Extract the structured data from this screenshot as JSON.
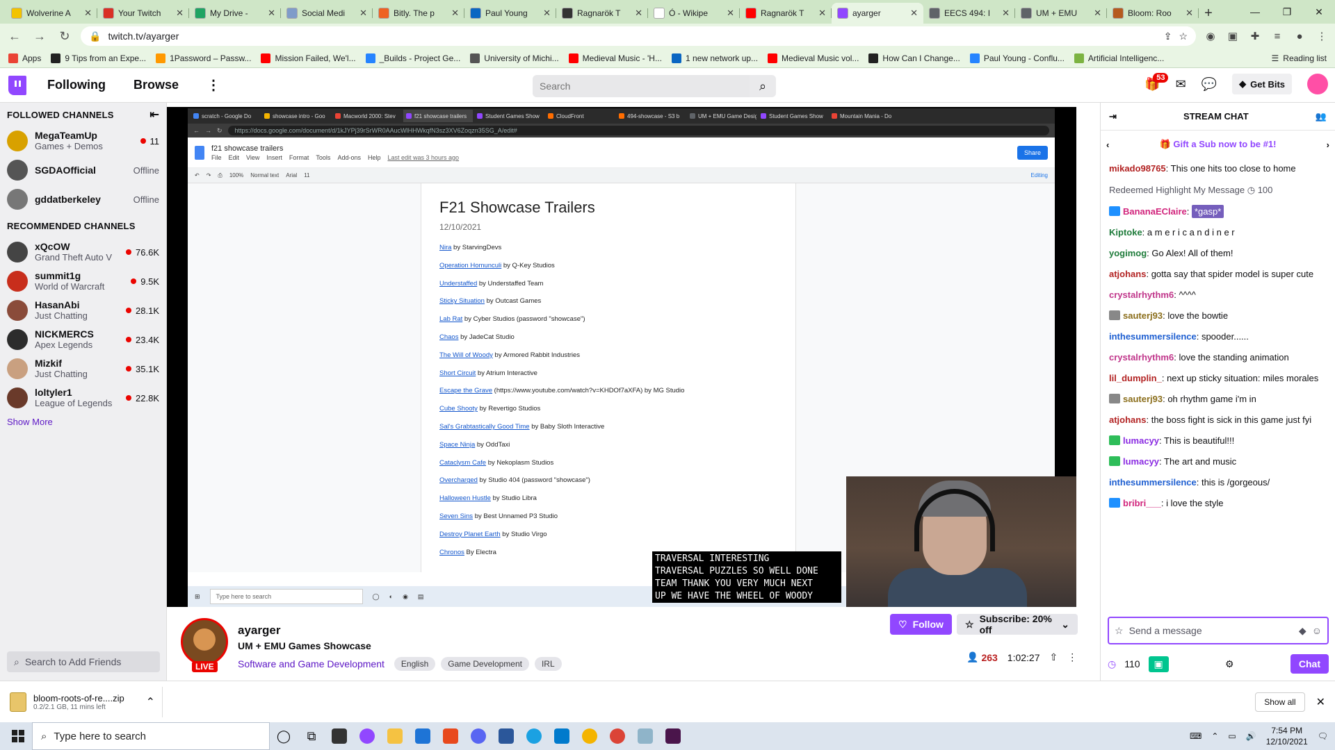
{
  "browser": {
    "tabs": [
      {
        "title": "Wolverine A",
        "color": "#f2c300"
      },
      {
        "title": "Your Twitch",
        "color": "#d93025"
      },
      {
        "title": "My Drive -",
        "color": "#1fa463"
      },
      {
        "title": "Social Medi",
        "color": "#7f9cc9"
      },
      {
        "title": "Bitly. The p",
        "color": "#ee6123"
      },
      {
        "title": "Paul Young",
        "color": "#0a66c2"
      },
      {
        "title": "Ragnarök T",
        "color": "#333333"
      },
      {
        "title": "Ó - Wikipe",
        "color": "#ffffff"
      },
      {
        "title": "Ragnarök T",
        "color": "#ff0000"
      },
      {
        "title": "ayarger",
        "color": "#9147ff"
      },
      {
        "title": "EECS 494: I",
        "color": "#5f6368"
      },
      {
        "title": "UM + EMU",
        "color": "#5f6368"
      },
      {
        "title": "Bloom: Roo",
        "color": "#b55a1e"
      }
    ],
    "url": "twitch.tv/ayarger",
    "bookmarks": [
      {
        "label": "Apps",
        "color": "#ea4335"
      },
      {
        "label": "9 Tips from an Expe...",
        "color": "#222222"
      },
      {
        "label": "1Password – Passw...",
        "color": "#ff9900"
      },
      {
        "label": "Mission Failed, We'l...",
        "color": "#ff0000"
      },
      {
        "label": "_Builds - Project Ge...",
        "color": "#2684ff"
      },
      {
        "label": "University of Michi...",
        "color": "#555555"
      },
      {
        "label": "Medieval Music - 'H...",
        "color": "#ff0000"
      },
      {
        "label": "1 new network up...",
        "color": "#0a66c2"
      },
      {
        "label": "Medieval Music vol...",
        "color": "#ff0000"
      },
      {
        "label": "How Can I Change...",
        "color": "#222222"
      },
      {
        "label": "Paul Young - Conflu...",
        "color": "#2684ff"
      },
      {
        "label": "Artificial Intelligenc...",
        "color": "#7cb342"
      }
    ],
    "reading_list": "Reading list"
  },
  "twitch": {
    "nav": {
      "following": "Following",
      "browse": "Browse",
      "search_placeholder": "Search",
      "notif_count": "53",
      "get_bits": "Get Bits"
    },
    "sidebar": {
      "followed_heading": "FOLLOWED CHANNELS",
      "followed": [
        {
          "name": "MegaTeamUp",
          "game": "Games + Demos",
          "status": "11",
          "live": true,
          "color": "#d8a100"
        },
        {
          "name": "SGDAOfficial",
          "game": "",
          "status": "Offline",
          "live": false,
          "color": "#555555"
        },
        {
          "name": "gddatberkeley",
          "game": "",
          "status": "Offline",
          "live": false,
          "color": "#777777"
        }
      ],
      "recommended_heading": "RECOMMENDED CHANNELS",
      "recommended": [
        {
          "name": "xQcOW",
          "game": "Grand Theft Auto V",
          "viewers": "76.6K",
          "color": "#444444"
        },
        {
          "name": "summit1g",
          "game": "World of Warcraft",
          "viewers": "9.5K",
          "color": "#c82e1c"
        },
        {
          "name": "HasanAbi",
          "game": "Just Chatting",
          "viewers": "28.1K",
          "color": "#8a4b3a"
        },
        {
          "name": "NICKMERCS",
          "game": "Apex Legends",
          "viewers": "23.4K",
          "color": "#2c2c2c"
        },
        {
          "name": "Mizkif",
          "game": "Just Chatting",
          "viewers": "35.1K",
          "color": "#c9a080"
        },
        {
          "name": "loltyler1",
          "game": "League of Legends",
          "viewers": "22.8K",
          "color": "#6a3a2a"
        }
      ],
      "show_more": "Show More",
      "friends_placeholder": "Search to Add Friends"
    },
    "stream": {
      "inner_tabs": [
        "scratch - Google Do",
        "showcase intro - Goo",
        "Macworld 2000: Stev",
        "f21 showcase trailers",
        "Student Games Show",
        "CloudFront",
        "494-showcase - S3 b",
        "UM + EMU Game Design",
        "Student Games Show",
        "Mountain Mania - Do"
      ],
      "inner_url": "https://docs.google.com/document/d/1kJYPj39rSrWR0AAucWlHHWkqfN3sz3XV6Zoqzn35SG_A/edit#",
      "doc_title": "f21 showcase trailers",
      "doc_menu": [
        "File",
        "Edit",
        "View",
        "Insert",
        "Format",
        "Tools",
        "Add-ons",
        "Help",
        "Last edit was 3 hours ago"
      ],
      "share": "Share",
      "toolbar": [
        "100%",
        "Normal text",
        "Arial",
        "11",
        "Editing"
      ],
      "heading": "F21 Showcase Trailers",
      "date": "12/10/2021",
      "entries": [
        {
          "link": "Nira",
          "rest": " by StarvingDevs"
        },
        {
          "link": "Operation Homunculi",
          "rest": " by Q-Key Studios"
        },
        {
          "link": "Understaffed",
          "rest": " by Understaffed Team"
        },
        {
          "link": "Sticky Situation",
          "rest": " by Outcast Games"
        },
        {
          "link": "Lab Rat",
          "rest": " by Cyber Studios (password \"showcase\")"
        },
        {
          "link": "Chaos",
          "rest": " by JadeCat Studio"
        },
        {
          "link": "The Will of Woody",
          "rest": " by Armored Rabbit Industries"
        },
        {
          "link": "Short Circuit",
          "rest": " by Atrium Interactive"
        },
        {
          "link": "Escape the Grave",
          "rest": " (https://www.youtube.com/watch?v=KHDOf7aXFA) by MG Studio"
        },
        {
          "link": "Cube Shooty",
          "rest": " by Revertigo Studios"
        },
        {
          "link": "Sal's Grabtastically Good Time",
          "rest": " by Baby Sloth Interactive"
        },
        {
          "link": "Space Ninja",
          "rest": " by OddTaxi"
        },
        {
          "link": "Cataclysm Cafe",
          "rest": " by Nekoplasm Studios"
        },
        {
          "link": "Overcharged",
          "rest": " by Studio 404 (password \"showcase\")"
        },
        {
          "link": "Halloween Hustle",
          "rest": " by Studio Libra"
        },
        {
          "link": "Seven Sins",
          "rest": " by Best Unnamed P3 Studio"
        },
        {
          "link": "Destroy Planet Earth",
          "rest": " by Studio Virgo"
        },
        {
          "link": "Chronos",
          "rest": " By Electra"
        }
      ],
      "inner_taskbar_search": "Type here to search",
      "caption": "TRAVERSAL INTERESTING\nTRAVERSAL PUZZLES SO WELL DONE\nTEAM THANK YOU VERY MUCH NEXT\nUP WE HAVE THE WHEEL OF WOODY"
    },
    "info": {
      "channel": "ayarger",
      "live_label": "LIVE",
      "title": "UM + EMU Games Showcase",
      "category": "Software and Game Development",
      "tags": [
        "English",
        "Game Development",
        "IRL"
      ],
      "follow": "Follow",
      "subscribe": "Subscribe: 20% off",
      "viewers": "263",
      "uptime": "1:02:27"
    },
    "chat": {
      "title": "STREAM CHAT",
      "gift": "Gift a Sub now to be #1!",
      "messages": [
        {
          "user": "mikado98765",
          "color": "#b22222",
          "text": "This one hits too close to home",
          "badge": ""
        },
        {
          "type": "redeem",
          "text": "Redeemed Highlight My Message",
          "points": "100"
        },
        {
          "user": "BananaEClaire",
          "color": "#d1247c",
          "text": "*gasp*",
          "badge": "#1e90ff",
          "highlight": true
        },
        {
          "user": "Kiptoke",
          "color": "#1e7b3a",
          "text": "a m e r i c a n d i n e r",
          "badge": ""
        },
        {
          "user": "yogimog",
          "color": "#1e7b3a",
          "text": "Go Alex! All of them!",
          "badge": ""
        },
        {
          "user": "atjohans",
          "color": "#b22222",
          "text": "gotta say that spider model is super cute",
          "badge": ""
        },
        {
          "user": "crystalrhythm6",
          "color": "#c0358a",
          "text": "^^^^",
          "badge": ""
        },
        {
          "user": "sauterj93",
          "color": "#8a6d1a",
          "text": "love the bowtie",
          "badge": "#888888"
        },
        {
          "user": "inthesummersilence",
          "color": "#1e5fd1",
          "text": "spooder......",
          "badge": ""
        },
        {
          "user": "crystalrhythm6",
          "color": "#c0358a",
          "text": "love the standing animation",
          "badge": ""
        },
        {
          "user": "lil_dumplin_",
          "color": "#b22222",
          "text": "next up sticky situation: miles morales",
          "badge": ""
        },
        {
          "user": "sauterj93",
          "color": "#8a6d1a",
          "text": "oh rhythm game i'm in",
          "badge": "#888888"
        },
        {
          "user": "atjohans",
          "color": "#b22222",
          "text": "the boss fight is sick in this game just fyi",
          "badge": ""
        },
        {
          "user": "lumacyy",
          "color": "#8a2be2",
          "text": "This is beautiful!!!",
          "badge": "#2ebd59"
        },
        {
          "user": "lumacyy",
          "color": "#8a2be2",
          "text": "The art and music",
          "badge": "#2ebd59"
        },
        {
          "user": "inthesummersilence",
          "color": "#1e5fd1",
          "text": "this is /gorgeous/",
          "badge": ""
        },
        {
          "user": "bribri___",
          "color": "#d1247c",
          "text": "i love the style",
          "badge": "#1e90ff"
        }
      ],
      "input_placeholder": "Send a message",
      "points": "110",
      "chat_button": "Chat"
    }
  },
  "downloads": {
    "file": "bloom-roots-of-re....zip",
    "progress": "0.2/2.1 GB, 11 mins left",
    "show_all": "Show all"
  },
  "taskbar": {
    "search": "Type here to search",
    "time": "7:54 PM",
    "date": "12/10/2021"
  }
}
